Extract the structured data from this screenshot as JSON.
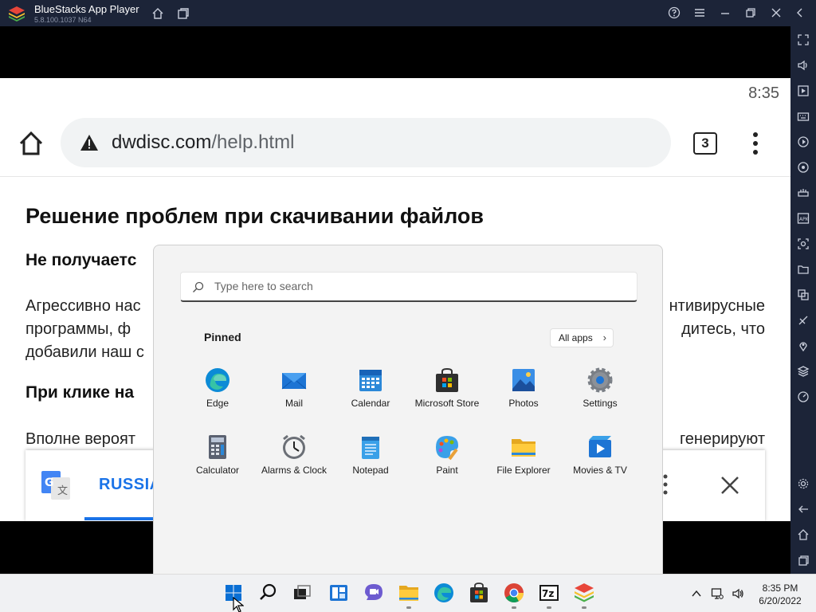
{
  "bluestacks": {
    "title": "BlueStacks App Player",
    "version": "5.8.100.1037 N64",
    "accent": "#1c2438"
  },
  "android": {
    "status_time": "8:35",
    "url_domain": "dwdisc.com",
    "url_path": "/help.html",
    "tab_count": "3"
  },
  "page": {
    "heading": "Решение проблем при скачивании файлов",
    "subheading_1": "Не получаетс",
    "para_1": [
      [
        "Агрессивно нас",
        "нтивирусные"
      ],
      [
        "программы,    ф",
        "дитесь,    что"
      ],
      [
        "добавили наш с",
        ""
      ]
    ],
    "subheading_2": "При клике на",
    "para_2": [
      [
        "Вполне вероят",
        "генерируют"
      ]
    ]
  },
  "translate_bar": {
    "language": "RUSSIA"
  },
  "start_menu": {
    "search_placeholder": "Type here to search",
    "pinned_label": "Pinned",
    "all_apps_label": "All apps",
    "apps": [
      {
        "label": "Edge",
        "icon": "edge-icon"
      },
      {
        "label": "Mail",
        "icon": "mail-icon"
      },
      {
        "label": "Calendar",
        "icon": "calendar-icon"
      },
      {
        "label": "Microsoft Store",
        "icon": "store-icon"
      },
      {
        "label": "Photos",
        "icon": "photos-icon"
      },
      {
        "label": "Settings",
        "icon": "settings-icon"
      },
      {
        "label": "Calculator",
        "icon": "calculator-icon"
      },
      {
        "label": "Alarms & Clock",
        "icon": "clock-icon"
      },
      {
        "label": "Notepad",
        "icon": "notepad-icon"
      },
      {
        "label": "Paint",
        "icon": "paint-icon"
      },
      {
        "label": "File Explorer",
        "icon": "folder-icon"
      },
      {
        "label": "Movies & TV",
        "icon": "movies-icon"
      }
    ]
  },
  "taskbar": {
    "time": "8:35 PM",
    "date": "6/20/2022"
  }
}
